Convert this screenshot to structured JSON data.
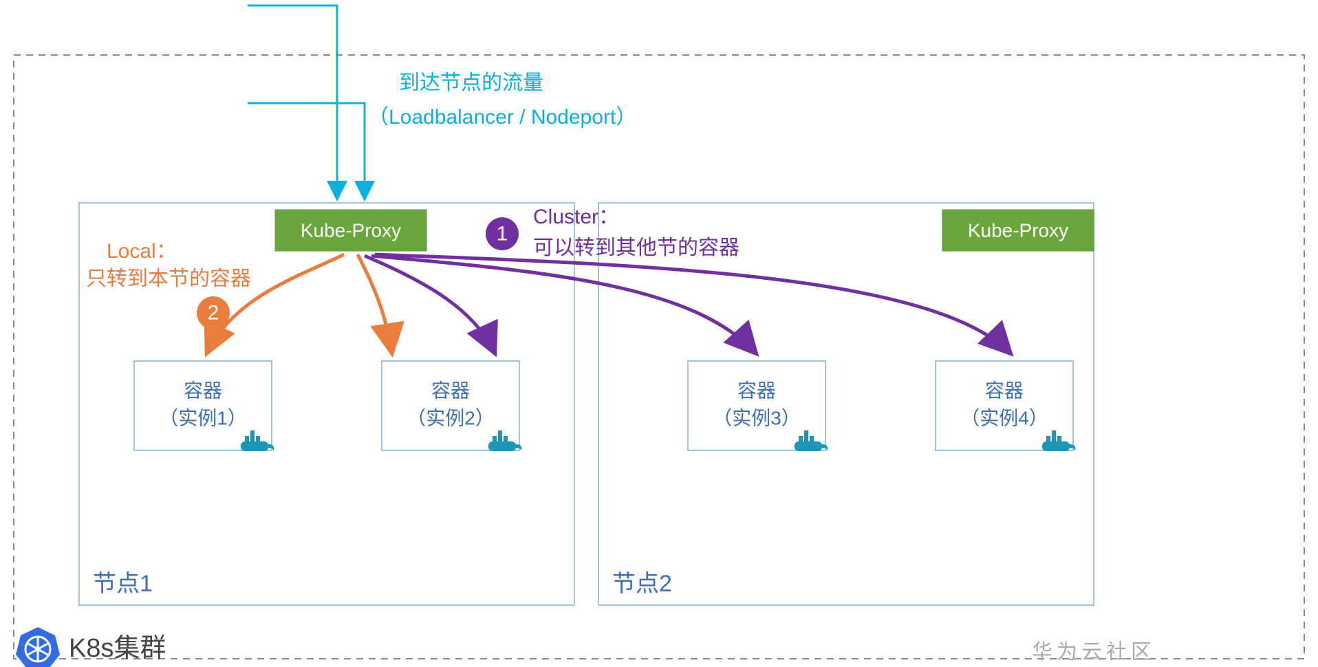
{
  "traffic": {
    "line1": "到达节点的流量",
    "line2": "（Loadbalancer / Nodeport）"
  },
  "proxy": {
    "label": "Kube-Proxy"
  },
  "clusterMode": {
    "title": "Cluster：",
    "desc": "可以转到其他节的容器",
    "badge": "1"
  },
  "localMode": {
    "title": "Local：",
    "desc": "只转到本节的容器",
    "badge": "2"
  },
  "nodes": {
    "node1": {
      "label": "节点1"
    },
    "node2": {
      "label": "节点2"
    }
  },
  "containers": {
    "c1": {
      "title": "容器",
      "instance": "（实例1）"
    },
    "c2": {
      "title": "容器",
      "instance": "（实例2）"
    },
    "c3": {
      "title": "容器",
      "instance": "（实例3）"
    },
    "c4": {
      "title": "容器",
      "instance": "（实例4）"
    }
  },
  "clusterLabel": "K8s集群",
  "watermark": "华为云社区",
  "colors": {
    "blue": "#0CB0DF",
    "purple": "#7030A0",
    "orange": "#EB7D3C",
    "green": "#69A63B",
    "nodeBorder": "#9DC3E6",
    "textBlue": "#3B6FB6"
  }
}
